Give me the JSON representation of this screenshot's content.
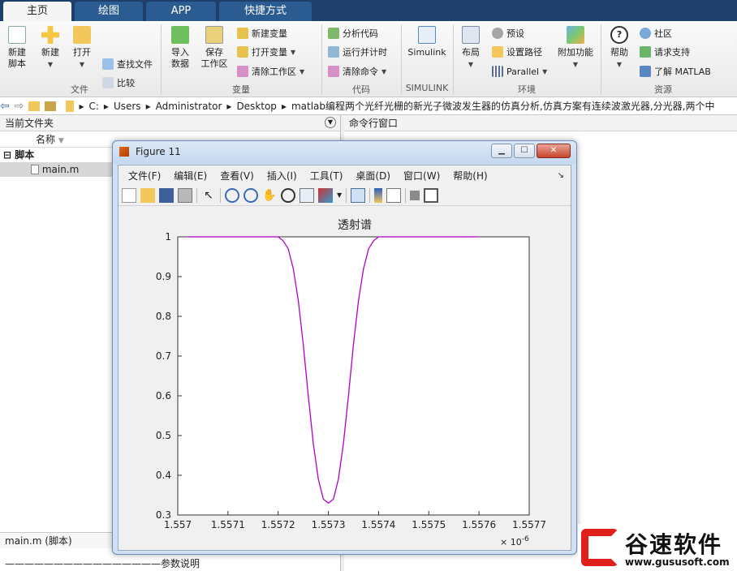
{
  "tabs": [
    {
      "label": "主页",
      "active": true
    },
    {
      "label": "绘图",
      "active": false
    },
    {
      "label": "APP",
      "active": false
    },
    {
      "label": "快捷方式",
      "active": false
    }
  ],
  "ribbon": {
    "file": {
      "new_script": "新建\n脚本",
      "new": "新建",
      "open": "打开",
      "find_files": "查找文件",
      "compare": "比较",
      "group": "文件"
    },
    "variable": {
      "import": "导入\n数据",
      "save_ws": "保存\n工作区",
      "new_var": "新建变量",
      "open_var": "打开变量",
      "clear_ws": "清除工作区",
      "group": "变量"
    },
    "code": {
      "analyze": "分析代码",
      "run_time": "运行并计时",
      "clear_cmd": "清除命令",
      "group": "代码"
    },
    "simulink": {
      "label": "Simulink",
      "group": "SIMULINK"
    },
    "env": {
      "layout": "布局",
      "prefs": "预设",
      "set_path": "设置路径",
      "parallel": "Parallel",
      "addons": "附加功能",
      "group": "环境"
    },
    "resources": {
      "help": "帮助",
      "community": "社区",
      "support": "请求支持",
      "learn": "了解 MATLAB",
      "group": "资源"
    }
  },
  "address": {
    "segments": [
      "C:",
      "Users",
      "Administrator",
      "Desktop",
      "matlab编程两个光纤光栅的新光子微波发生器的仿真分析,仿真方案有连续波激光器,分光器,两个中"
    ]
  },
  "left_panel": {
    "title": "当前文件夹",
    "col_name": "名称",
    "group": "脚本",
    "file": "main.m",
    "detail_title": "main.m  (脚本)",
    "detail_text": "————————————————参数说明"
  },
  "right_panel": {
    "title": "命令行窗口"
  },
  "figure": {
    "title": "Figure 11",
    "menu": [
      "文件(F)",
      "编辑(E)",
      "查看(V)",
      "插入(I)",
      "工具(T)",
      "桌面(D)",
      "窗口(W)",
      "帮助(H)"
    ]
  },
  "chart_data": {
    "type": "line",
    "title": "透射谱",
    "xlabel": "",
    "ylabel": "",
    "x_exponent_label": "× 10^-6",
    "xlim": [
      1.557,
      1.5577
    ],
    "ylim": [
      0.3,
      1
    ],
    "xticks": [
      "1.557",
      "1.5571",
      "1.5572",
      "1.5573",
      "1.5574",
      "1.5575",
      "1.5576",
      "1.5577"
    ],
    "yticks": [
      "0.3",
      "0.4",
      "0.5",
      "0.6",
      "0.7",
      "0.8",
      "0.9",
      "1"
    ],
    "line_color": "#b000c8",
    "series": [
      {
        "x": [
          1.55702,
          1.55715,
          1.5572,
          1.55721,
          1.55722,
          1.55723,
          1.55724,
          1.55725,
          1.55726,
          1.55727,
          1.55728,
          1.55729,
          1.5573,
          1.55731,
          1.55732,
          1.55733,
          1.55734,
          1.55735,
          1.55736,
          1.55737,
          1.55738,
          1.55739,
          1.5574,
          1.55745,
          1.5576
        ],
        "y": [
          1.0,
          1.0,
          1.0,
          0.99,
          0.97,
          0.92,
          0.84,
          0.73,
          0.6,
          0.48,
          0.39,
          0.34,
          0.33,
          0.34,
          0.39,
          0.48,
          0.6,
          0.73,
          0.84,
          0.92,
          0.97,
          0.99,
          1.0,
          1.0,
          1.0
        ]
      }
    ]
  },
  "watermark": {
    "brand": "谷速软件",
    "url": "www.gususoft.com"
  }
}
